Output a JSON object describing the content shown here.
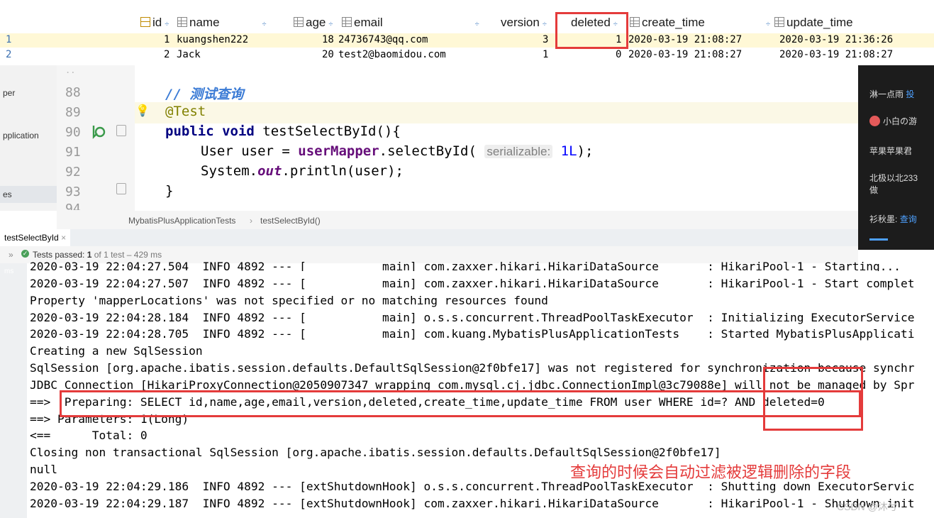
{
  "grid": {
    "headers": [
      {
        "label": "id",
        "icon": "key-icon"
      },
      {
        "label": "name",
        "icon": "table-column-icon"
      },
      {
        "label": "age",
        "icon": "table-column-icon"
      },
      {
        "label": "email",
        "icon": "table-column-icon"
      },
      {
        "label": "version",
        "icon": ""
      },
      {
        "label": "deleted",
        "icon": ""
      },
      {
        "label": "create_time",
        "icon": "table-column-icon"
      },
      {
        "label": "update_time",
        "icon": "table-column-icon"
      }
    ],
    "sort_glyph": "÷",
    "rows": [
      {
        "n": "1",
        "id": "1",
        "name": "kuangshen222",
        "age": "18",
        "email": "24736743@qq.com",
        "version": "3",
        "deleted": "1",
        "create_time": "2020-03-19 21:08:27",
        "update_time": "2020-03-19 21:36:26"
      },
      {
        "n": "2",
        "id": "2",
        "name": "Jack",
        "age": "20",
        "email": "test2@baomidou.com",
        "version": "1",
        "deleted": "0",
        "create_time": "2020-03-19 21:08:27",
        "update_time": "2020-03-19 21:08:27"
      }
    ]
  },
  "project": {
    "items": [
      "per",
      "pplication",
      "es"
    ]
  },
  "editor": {
    "lines": [
      "88",
      "89",
      "90",
      "91",
      "92",
      "93",
      "94"
    ],
    "comment": "// 测试查询",
    "annotation": "@Test",
    "sig_kw1": "public",
    "sig_kw2": "void",
    "sig_rest": " testSelectById(){",
    "l91_a": "User user = ",
    "l91_field": "userMapper",
    "l91_b": ".selectById(",
    "l91_hint": "serializable:",
    "l91_num": "1L",
    "l91_c": ");",
    "l92_a": "System.",
    "l92_static": "out",
    "l92_b": ".println(user);",
    "l93": "}",
    "crumb_class": "MybatisPlusApplicationTests",
    "crumb_sep": "›",
    "crumb_method": "testSelectById()"
  },
  "comments_panel": [
    {
      "user": "淋一点雨",
      "text": "投"
    },
    {
      "user": "小白の游",
      "text": ""
    },
    {
      "user": "苹果苹果君",
      "text": ""
    },
    {
      "user": "北极以北233",
      "text": "做"
    },
    {
      "user": "衫秋墨:",
      "text": "查询"
    }
  ],
  "run": {
    "tab": "testSelectById",
    "tab_close": "×",
    "status_prefix": "»",
    "status_label": "Tests passed:",
    "status_count": "1",
    "status_rest": "of 1 test – 429 ms",
    "side_label": "ms"
  },
  "console": {
    "lines": [
      "2020-03-19 22:04:27.504  INFO 4892 --- [           main] com.zaxxer.hikari.HikariDataSource       : HikariPool-1 - Starting...",
      "2020-03-19 22:04:27.507  INFO 4892 --- [           main] com.zaxxer.hikari.HikariDataSource       : HikariPool-1 - Start complet",
      "Property 'mapperLocations' was not specified or no matching resources found",
      "2020-03-19 22:04:28.184  INFO 4892 --- [           main] o.s.s.concurrent.ThreadPoolTaskExecutor  : Initializing ExecutorService",
      "2020-03-19 22:04:28.705  INFO 4892 --- [           main] com.kuang.MybatisPlusApplicationTests    : Started MybatisPlusApplicati",
      "Creating a new SqlSession",
      "SqlSession [org.apache.ibatis.session.defaults.DefaultSqlSession@2f0bfe17] was not registered for synchronization because synchr",
      "JDBC Connection [HikariProxyConnection@2050907347 wrapping com.mysql.cj.jdbc.ConnectionImpl@3c79088e] will not be managed by Spr",
      "==>  Preparing: SELECT id,name,age,email,version,deleted,create_time,update_time FROM user WHERE id=? AND deleted=0",
      "==> Parameters: 1(Long)",
      "<==      Total: 0",
      "Closing non transactional SqlSession [org.apache.ibatis.session.defaults.DefaultSqlSession@2f0bfe17]",
      "null",
      "2020-03-19 22:04:29.186  INFO 4892 --- [extShutdownHook] o.s.s.concurrent.ThreadPoolTaskExecutor  : Shutting down ExecutorServic",
      "2020-03-19 22:04:29.187  INFO 4892 --- [extShutdownHook] com.zaxxer.hikari.HikariDataSource       : HikariPool-1 - Shutdown init"
    ],
    "annotation": "查询的时候会自动过滤被逻辑删除的字段",
    "watermark": "CSDN @沐兮"
  },
  "colors": {
    "highlight_red": "#e43b3b",
    "row_highlight": "#fff8d6"
  }
}
